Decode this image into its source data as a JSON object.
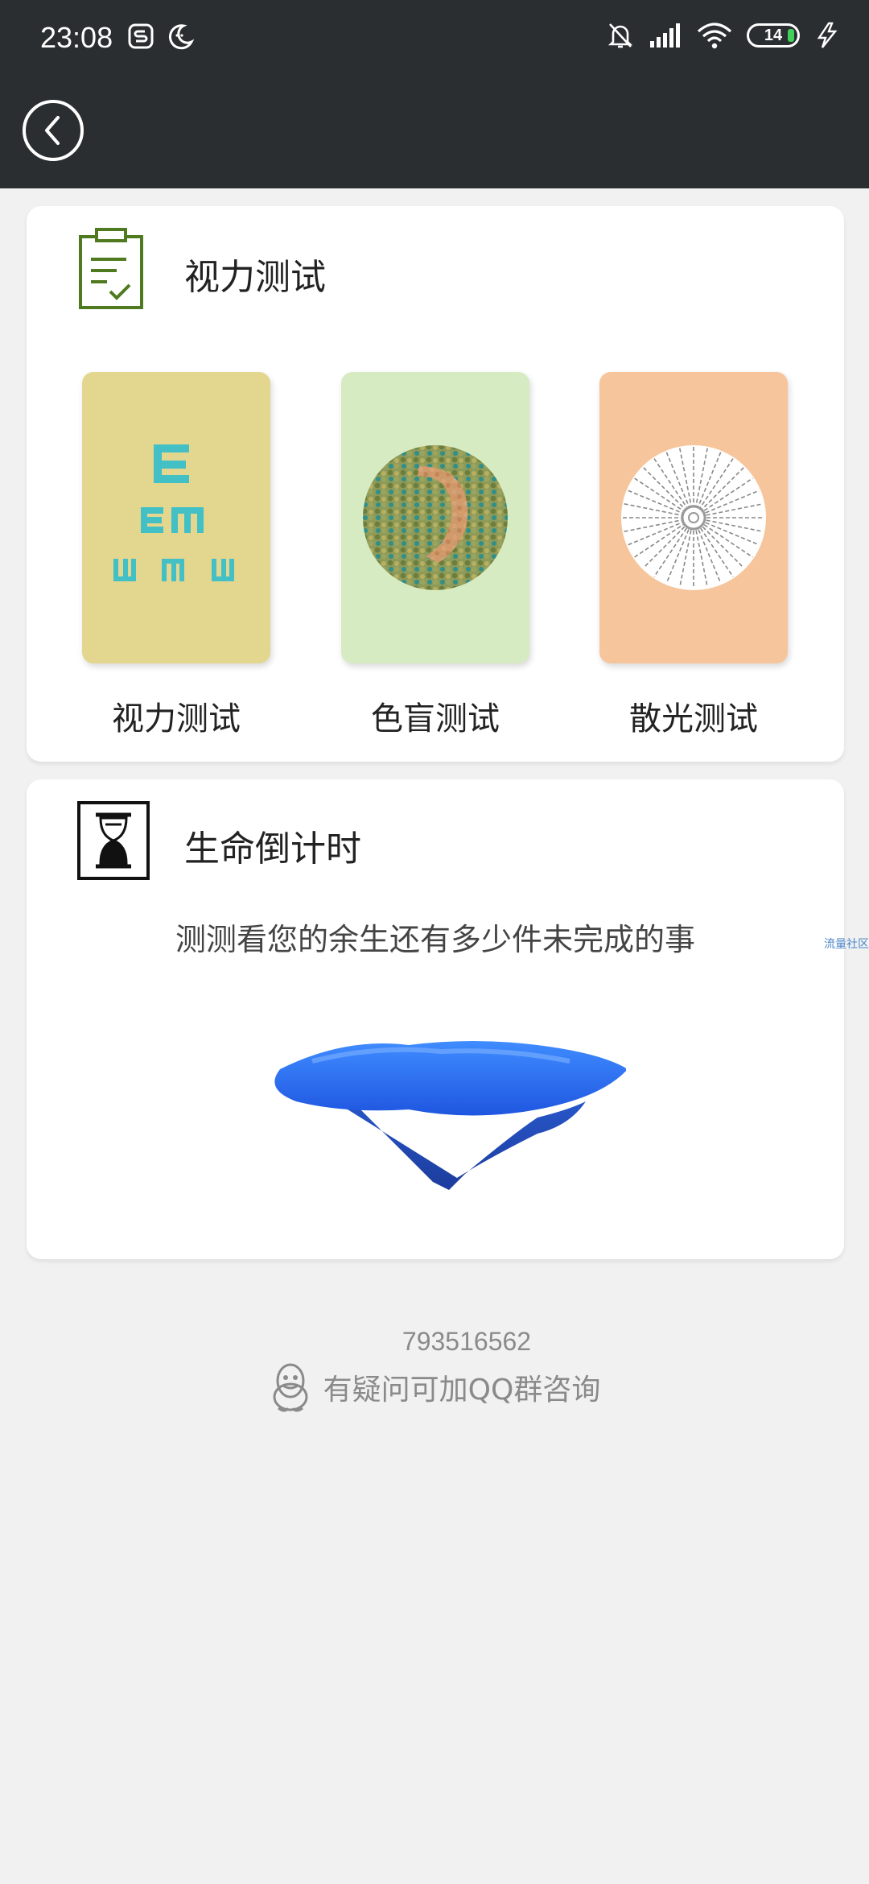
{
  "status_bar": {
    "time": "23:08",
    "battery": "14"
  },
  "vision_card": {
    "title": "视力测试",
    "tiles": [
      {
        "label": "视力测试",
        "bg": "#e3d68e"
      },
      {
        "label": "色盲测试",
        "bg": "#d6ebc2"
      },
      {
        "label": "散光测试",
        "bg": "#f6c59b"
      }
    ]
  },
  "life_card": {
    "title": "生命倒计时",
    "subtitle": "测测看您的余生还有多少件未完成的事"
  },
  "side_tag": "流量社区",
  "footer": {
    "qq_number": "793516562",
    "qq_text": "有疑问可加QQ群咨询"
  },
  "colors": {
    "topbar": "#2a2e30",
    "accent_green": "#4f7a1f",
    "eye_chart": "#43bfc6"
  }
}
